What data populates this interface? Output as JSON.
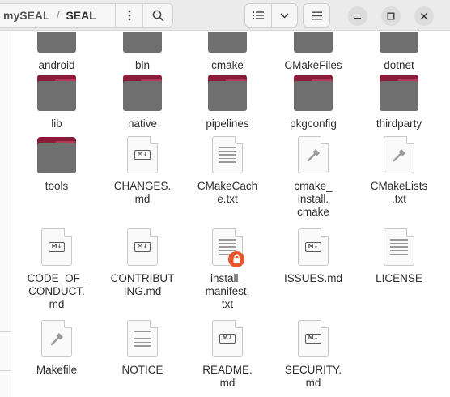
{
  "header": {
    "breadcrumb": [
      "mySEAL",
      "SEAL"
    ],
    "separator": "/",
    "path_menu_icon": "kebab-icon",
    "search_icon": "search-icon",
    "view_icon": "list-view-icon",
    "view_dropdown_icon": "chevron-down-icon",
    "main_menu_icon": "hamburger-icon",
    "window_buttons": [
      "minimize-icon",
      "maximize-icon",
      "close-icon"
    ]
  },
  "colors": {
    "folder_tab": "#8a1c3a",
    "folder_body": "#6f6f6f",
    "lock_badge": "#e8542c"
  },
  "files": [
    {
      "label": "android",
      "kind": "folder"
    },
    {
      "label": "bin",
      "kind": "folder"
    },
    {
      "label": "cmake",
      "kind": "folder"
    },
    {
      "label": "CMakeFiles",
      "kind": "folder"
    },
    {
      "label": "dotnet",
      "kind": "folder"
    },
    {
      "label": "lib",
      "kind": "folder"
    },
    {
      "label": "native",
      "kind": "folder"
    },
    {
      "label": "pipelines",
      "kind": "folder"
    },
    {
      "label": "pkgconfig",
      "kind": "folder"
    },
    {
      "label": "thirdparty",
      "kind": "folder"
    },
    {
      "label": "tools",
      "kind": "folder"
    },
    {
      "label": "CHANGES.\nmd",
      "kind": "markdown"
    },
    {
      "label": "CMakeCach\ne.txt",
      "kind": "text"
    },
    {
      "label": "cmake_\ninstall.\ncmake",
      "kind": "script"
    },
    {
      "label": "CMakeLists\n.txt",
      "kind": "script"
    },
    {
      "label": "CODE_OF_\nCONDUCT.\nmd",
      "kind": "markdown"
    },
    {
      "label": "CONTRIBUT\nING.md",
      "kind": "markdown"
    },
    {
      "label": "install_\nmanifest.\ntxt",
      "kind": "text-locked"
    },
    {
      "label": "ISSUES.md",
      "kind": "markdown"
    },
    {
      "label": "LICENSE",
      "kind": "text"
    },
    {
      "label": "Makefile",
      "kind": "script"
    },
    {
      "label": "NOTICE",
      "kind": "text"
    },
    {
      "label": "README.\nmd",
      "kind": "markdown"
    },
    {
      "label": "SECURITY.\nmd",
      "kind": "markdown"
    }
  ],
  "md_badge": "M↓"
}
